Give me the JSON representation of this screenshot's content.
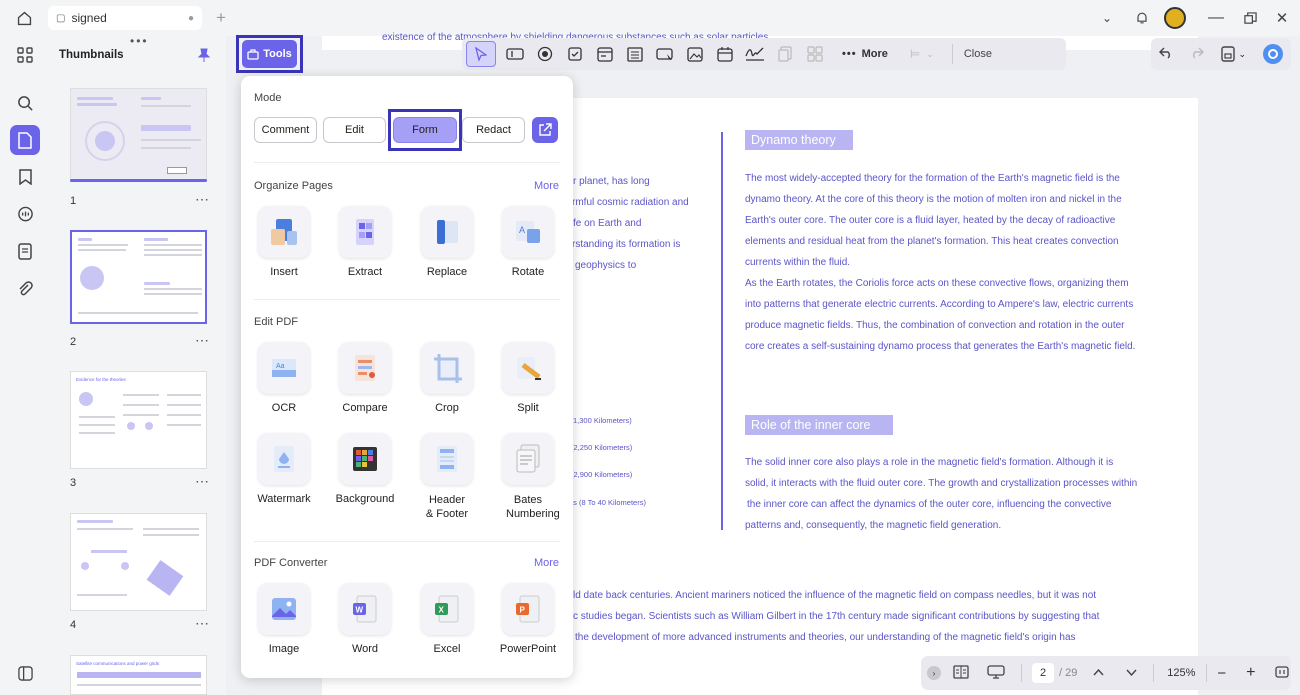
{
  "window": {
    "tab_title": "signed"
  },
  "thumbnails": {
    "title": "Thumbnails",
    "pages": [
      "1",
      "2",
      "3",
      "4"
    ],
    "page3_caption": "Evidence for the theories",
    "page5_caption": "Satellite communications and power grids"
  },
  "tools_button": {
    "label": "Tools"
  },
  "toolbar": {
    "more_label": "More",
    "close_label": "Close"
  },
  "popup": {
    "mode_title": "Mode",
    "modes": [
      "Comment",
      "Edit",
      "Form",
      "Redact"
    ],
    "organize_title": "Organize Pages",
    "organize_more": "More",
    "organize_tools": [
      "Insert",
      "Extract",
      "Replace",
      "Rotate"
    ],
    "edit_title": "Edit PDF",
    "edit_tools": [
      "OCR",
      "Compare",
      "Crop",
      "Split",
      "Watermark",
      "Background",
      "Header & Footer",
      "Bates Numbering"
    ],
    "converter_title": "PDF Converter",
    "converter_more": "More",
    "converter_tools": [
      "Image",
      "Word",
      "Excel",
      "PowerPoint"
    ]
  },
  "document": {
    "top_line": "existence of the atmosphere by shielding dangerous substances such as solar particles",
    "left_fragments": [
      "r planet, has long",
      "rmful cosmic radiation and",
      "fe on Earth and",
      "rstanding its formation is",
      "geophysics to"
    ],
    "layer_labels": [
      "1,300 Kilometers)",
      "(2,250 Kilometers)",
      "(2,900 Kilometers)",
      "as (8 To 40 Kilometers)"
    ],
    "heading1": "Dynamo theory",
    "para1": [
      "The most widely-accepted theory for the formation of the Earth's magnetic field is the",
      "dynamo theory. At the core of this theory is the motion of molten iron and nickel in the",
      "Earth's outer core. The outer core is a fluid layer, heated by the decay of radioactive",
      "elements and residual heat from the planet's formation. This heat creates convection",
      "currents within the fluid.",
      "As the Earth rotates, the Coriolis force acts on these convective flows, organizing them",
      "into patterns that generate electric currents. According to Ampere's law, electric currents",
      "produce magnetic fields. Thus, the combination of convection and rotation in the outer",
      "core creates a self-sustaining dynamo process that generates the Earth's magnetic field."
    ],
    "heading2": "Role of the inner core",
    "para2": [
      "The solid inner core also plays a role in the magnetic field's formation. Although it is",
      "solid, it interacts with the fluid outer core. The growth and crystallization processes within",
      "the inner core can affect the dynamics of the outer core, influencing the convective",
      "patterns and, consequently, the magnetic field generation."
    ],
    "bottom_lines": [
      "ld date back centuries. Ancient mariners noticed the influence of the magnetic field on compass needles, but it was not",
      "c studies began. Scientists such as William Gilbert in the 17th century made significant contributions by suggesting that",
      "the development of more advanced instruments and theories, our understanding of the magnetic field's origin has"
    ]
  },
  "statusbar": {
    "current_page": "2",
    "total_pages": "/ 29",
    "zoom": "125%"
  },
  "colors": {
    "accent": "#6b63e8",
    "highlight_border": "#3a35b8",
    "doc_text": "#5b55c8"
  }
}
